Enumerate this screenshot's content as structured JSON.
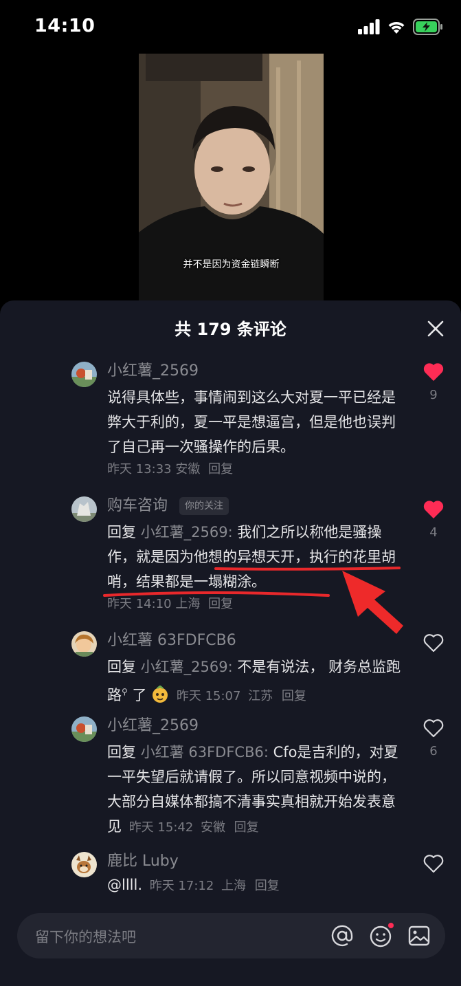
{
  "status": {
    "time": "14:10"
  },
  "video": {
    "subtitle": "并不是因为资金链瞬断"
  },
  "comments_panel": {
    "title": "共 179 条评论",
    "input_placeholder": "留下你的想法吧"
  },
  "comments": [
    {
      "username": "小红薯_2569",
      "text": "说得具体些，事情闹到这么大对夏一平已经是弊大于利的，夏一平是想逼宫，但是他也误判了自己再一次骚操作的后果。",
      "time": "昨天 13:33",
      "location": "安徽",
      "reply_label": "回复",
      "likes": "9",
      "liked": true
    },
    {
      "username": "购车咨询",
      "tag": "你的关注",
      "reply_prefix": "回复",
      "reply_to": "小红薯_2569",
      "text": "我们之所以称他是骚操作，就是因为他想的异想天开，执行的花里胡哨，结果都是一塌糊涂。",
      "time": "昨天 14:10",
      "location": "上海",
      "reply_label": "回复",
      "likes": "4",
      "liked": true
    },
    {
      "username": "小红薯 63FDFCB6",
      "reply_prefix": "回复",
      "reply_to": "小红薯_2569",
      "text": "不是有说法， 财务总监跑路",
      "text_suffix": "了",
      "time": "昨天 15:07",
      "location": "江苏",
      "reply_label": "回复",
      "liked": false
    },
    {
      "username": "小红薯_2569",
      "reply_prefix": "回复",
      "reply_to": "小红薯 63FDFCB6",
      "text": "Cfo是吉利的，对夏一平失望后就请假了。所以同意视频中说的，大部分自媒体都搞不清事实真相就开始发表意见",
      "time": "昨天 15:42",
      "location": "安徽",
      "reply_label": "回复",
      "likes": "6",
      "liked": false
    },
    {
      "username": "鹿比 Luby",
      "text": "@llll.",
      "time": "昨天 17:12",
      "location": "上海",
      "reply_label": "回复",
      "liked": false
    }
  ],
  "icons": {
    "close": "close-icon",
    "heart_filled": "heart-filled-icon",
    "heart_outline": "heart-outline-icon",
    "mention": "at-icon",
    "emoji": "emoji-icon",
    "image": "image-icon"
  },
  "colors": {
    "like_red": "#fe2c55",
    "background": "#161823",
    "annotation_red": "#e8282b"
  }
}
